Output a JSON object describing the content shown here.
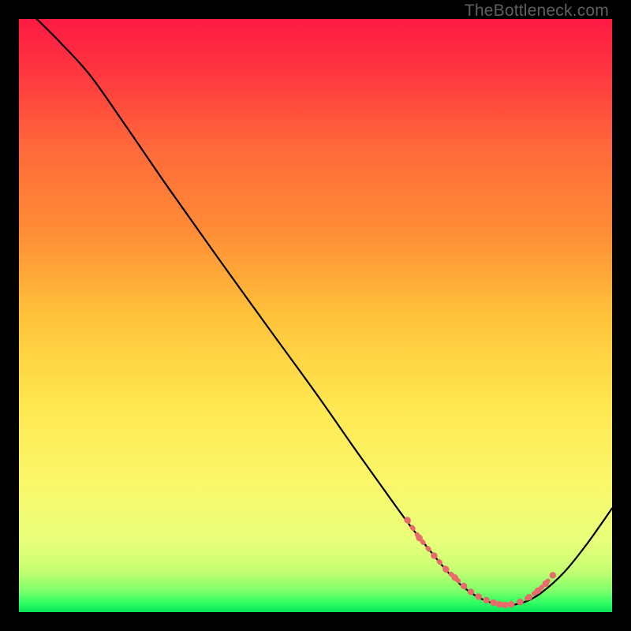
{
  "watermark": "TheBottleneck.com",
  "gradient": {
    "stops": [
      {
        "offset": 0.0,
        "color": "#ff1a44"
      },
      {
        "offset": 0.1,
        "color": "#ff3a3f"
      },
      {
        "offset": 0.22,
        "color": "#ff6a3a"
      },
      {
        "offset": 0.35,
        "color": "#ff8a36"
      },
      {
        "offset": 0.5,
        "color": "#ffc23a"
      },
      {
        "offset": 0.65,
        "color": "#ffe750"
      },
      {
        "offset": 0.78,
        "color": "#fbf76a"
      },
      {
        "offset": 0.88,
        "color": "#e8ff7a"
      },
      {
        "offset": 0.93,
        "color": "#c6ff72"
      },
      {
        "offset": 0.965,
        "color": "#7cff6a"
      },
      {
        "offset": 0.985,
        "color": "#2eff62"
      },
      {
        "offset": 1.0,
        "color": "#08e35a"
      }
    ]
  },
  "chart_data": {
    "type": "line",
    "title": "",
    "xlabel": "",
    "ylabel": "",
    "xlim": [
      0,
      100
    ],
    "ylim": [
      0,
      100
    ],
    "series": [
      {
        "name": "curve",
        "x": [
          0,
          3,
          7,
          12,
          18,
          25,
          33,
          42,
          50,
          57,
          62,
          66,
          70,
          73,
          76,
          79,
          82,
          85,
          88,
          92,
          96,
          100
        ],
        "y": [
          103,
          100,
          96,
          90.5,
          82,
          71.8,
          60.5,
          48,
          37,
          27,
          20,
          14.5,
          9.5,
          6,
          3.4,
          1.8,
          1.2,
          1.6,
          3.2,
          6.8,
          11.8,
          17.5
        ]
      }
    ],
    "valley_markers": {
      "name": "valley-dots",
      "color": "#e86a6a",
      "x": [
        65.5,
        67.5,
        70,
        72,
        73.5,
        75,
        76.2,
        77.5,
        78.8,
        80,
        81,
        82,
        83,
        84.5,
        86,
        87.5,
        88.8,
        90
      ],
      "y": [
        15.5,
        12.5,
        9.5,
        7.2,
        5.8,
        4.4,
        3.4,
        2.6,
        2.0,
        1.6,
        1.3,
        1.2,
        1.3,
        1.7,
        2.5,
        3.6,
        4.8,
        6.2
      ]
    }
  }
}
